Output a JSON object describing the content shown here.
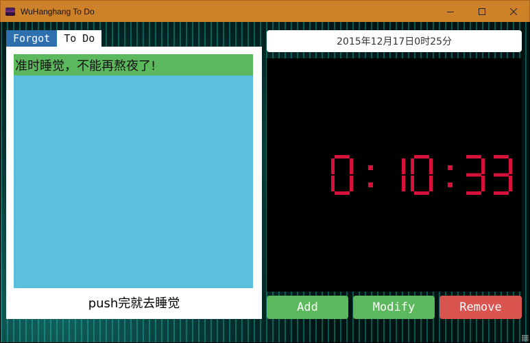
{
  "window": {
    "title": "WuHanghang To Do",
    "icon": "app-icon",
    "controls": [
      "minimize-icon",
      "maximize-icon",
      "close-icon"
    ]
  },
  "tabs": [
    {
      "label": "Forgot",
      "active": true
    },
    {
      "label": "To Do",
      "active": false
    }
  ],
  "notes": {
    "items": [
      "准时睡觉，不能再熬夜了!"
    ],
    "caption": "push完就去睡觉"
  },
  "datetime": "2015年12月17日0时25分",
  "clock": {
    "display": "0:10:33",
    "color": "#d6123a"
  },
  "buttons": {
    "add": "Add",
    "modify": "Modify",
    "remove": "Remove"
  },
  "colors": {
    "titlebar": "#cd8128",
    "tab_active": "#2e6fb0",
    "note_area": "#5bc0de",
    "note_item": "#5cb85c",
    "button_green": "#5cb85c",
    "button_red": "#d9534f"
  }
}
